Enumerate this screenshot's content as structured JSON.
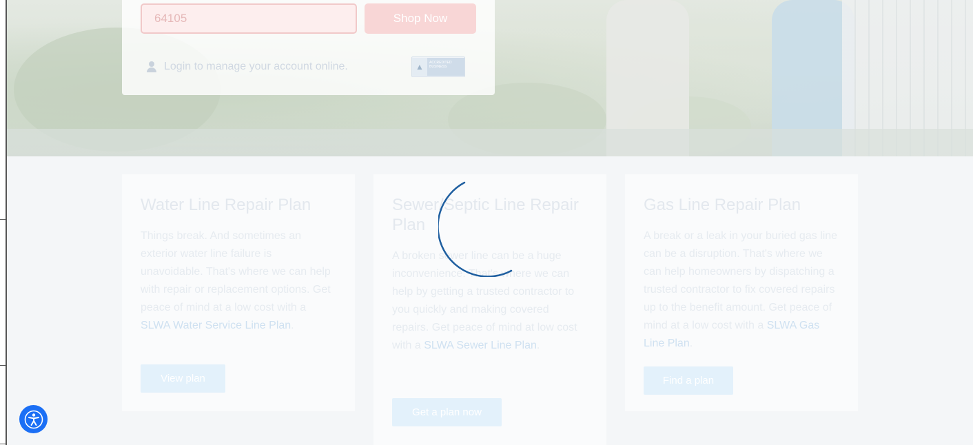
{
  "shop": {
    "zip_value": "64105",
    "shop_label": "Shop Now",
    "login_text": "Login to manage your account online.",
    "bbb_text": "ACCREDITED BUSINESS"
  },
  "cards": [
    {
      "title": "Water Line Repair Plan",
      "body": "Things break. And sometimes an exterior water line failure is unavoidable. That's where we can help with repair or replacement options. Get peace of mind at a low cost with a ",
      "link": "SLWA Water Service Line Plan",
      "suffix": ".",
      "button": "View plan"
    },
    {
      "title": "Sewer/Septic Line Repair Plan",
      "body": "A broken sewer line can be a huge inconvenience. That's where we can help by getting a trusted contractor to you quickly and making covered repairs. Get peace of mind at low cost with a ",
      "link": "SLWA Sewer Line Plan",
      "suffix": ".",
      "button": "Get a plan now"
    },
    {
      "title": "Gas Line Repair Plan",
      "body": "A break or a leak in your buried gas line can be a disruption. That's where we can help homeowners by dispatching a trusted contractor to fix covered repairs up to the benefit amount. Get peace of mind at a low cost with a ",
      "link": "SLWA Gas Line Plan",
      "suffix": ".",
      "button": "Find a plan"
    }
  ],
  "colors": {
    "spinner": "#1f5fa0",
    "accessibility_button": "#1b6ff5",
    "shop_button": "#f8d6d6"
  },
  "icons": {
    "login": "user-icon",
    "accessibility": "accessibility-icon",
    "loading": "loading-spinner"
  }
}
